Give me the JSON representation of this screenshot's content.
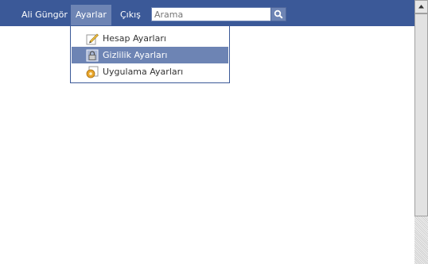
{
  "nav": {
    "profile_name": "Ali Güngör",
    "settings_label": "Ayarlar",
    "logout_label": "Çıkış"
  },
  "search": {
    "placeholder": "Arama",
    "icon": "search-icon"
  },
  "settings_menu": {
    "items": [
      {
        "label": "Hesap Ayarları",
        "icon": "pencil-icon"
      },
      {
        "label": "Gizlilik Ayarları",
        "icon": "lock-icon"
      },
      {
        "label": "Uygulama Ayarları",
        "icon": "app-icon"
      }
    ]
  },
  "colors": {
    "header_bg": "#3b5998",
    "active_bg": "#6d84b4",
    "menu_border": "#3b5998"
  }
}
